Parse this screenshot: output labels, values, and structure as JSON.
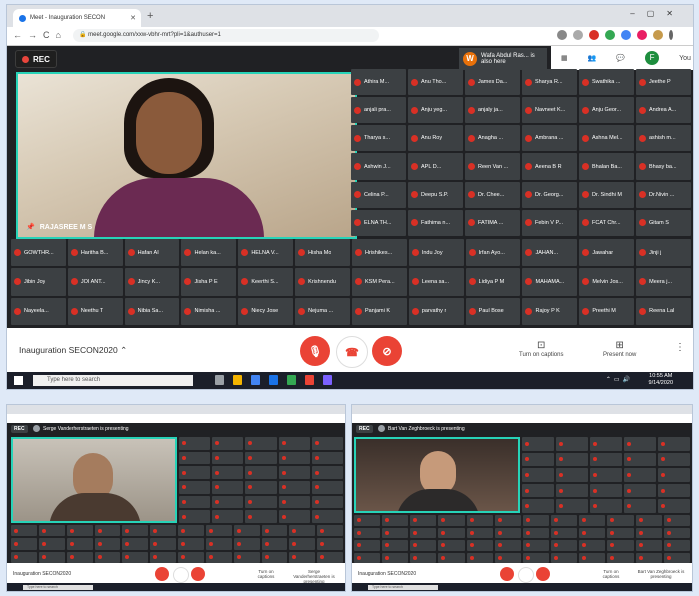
{
  "top": {
    "tab_title": "Meet - Inauguration SECON",
    "url": "meet.google.com/xxw-vbhr-mrt?pli=1&authuser=1",
    "rec_label": "REC",
    "joined_avatar": "W",
    "joined_text": "Wafa Abdul Ras... is also here",
    "you_label": "You",
    "you_avatar": "F",
    "presenter_name": "RAJASREE M S",
    "tiles_right": [
      "Athira M...",
      "Anu Tho...",
      "James Da...",
      "Sharya R...",
      "Swathika ...",
      "Jeethe P",
      "anjali pra...",
      "Anju yeg...",
      "anjaly ja...",
      "Navneet K...",
      "Anju Geor...",
      "Andrea A...",
      "Tharya s...",
      "Anu Roy",
      "Anagha ...",
      "Ambrana ...",
      "Ashna Mel...",
      "ashish m...",
      "Ashwin J...",
      "APL D...",
      "Reen Van ...",
      "Aeena B R",
      "Bhalan Ba...",
      "Bhasy ba...",
      "Celina P...",
      "Deepu S.P.",
      "Dr. Chee...",
      "Dr. Georg...",
      "Dr. Sindhi M",
      "Dr.Nivin ...",
      "ELNA TH...",
      "Fathima n...",
      "FATIMA ...",
      "Febin V P...",
      "FCAT Chr...",
      "Gitam S"
    ],
    "tiles_full": [
      "GOWTHR...",
      "Haritha B...",
      "Hafan AI",
      "Helan ka...",
      "HELNA V...",
      "Hisha Mo",
      "Hrishikes...",
      "Indu Joy",
      "Irfan Ayo...",
      "JAHAN...",
      "Jawahar",
      "Jinji j",
      "Jibin Joy",
      "JOI ANT...",
      "Jincy K...",
      "Jisha P E",
      "Keerthi S...",
      "Krishnendu",
      "KSM Pera...",
      "Leena sa...",
      "Lidiya P M",
      "MAHAMA...",
      "Melvin Jos...",
      "Meera j...",
      "Nayeela...",
      "Neethu T",
      "Nibia Sa...",
      "Nimisha ...",
      "Niecy Jose",
      "Nejuma ...",
      "Panjami K",
      "parvathy r",
      "Paul Bose",
      "Rajoy P K",
      "Preethi M",
      "Reena Lal"
    ],
    "meeting_title": "Inauguration SECON2020",
    "captions_label": "Turn on captions",
    "present_label": "Present now",
    "search_placeholder": "Type here to search",
    "time": "10:55 AM",
    "date": "9/14/2020"
  },
  "bottom_left": {
    "presenting_text": "Serge Vanderherstraeten is presenting",
    "meeting_title": "Inauguration SECON2020",
    "captions_label": "Turn on captions",
    "present_label": "Serge Vanderherstraeten is presenting"
  },
  "bottom_right": {
    "presenting_text": "Bart Van Zeghbroeck is presenting",
    "meeting_title": "Inauguration SECON2020",
    "captions_label": "Turn on captions",
    "present_label": "Bart Van Zeghbroeck is presenting"
  },
  "colors": {
    "accent_teal": "#27d3b8",
    "mute_red": "#d93025",
    "meet_dark": "#202124"
  }
}
